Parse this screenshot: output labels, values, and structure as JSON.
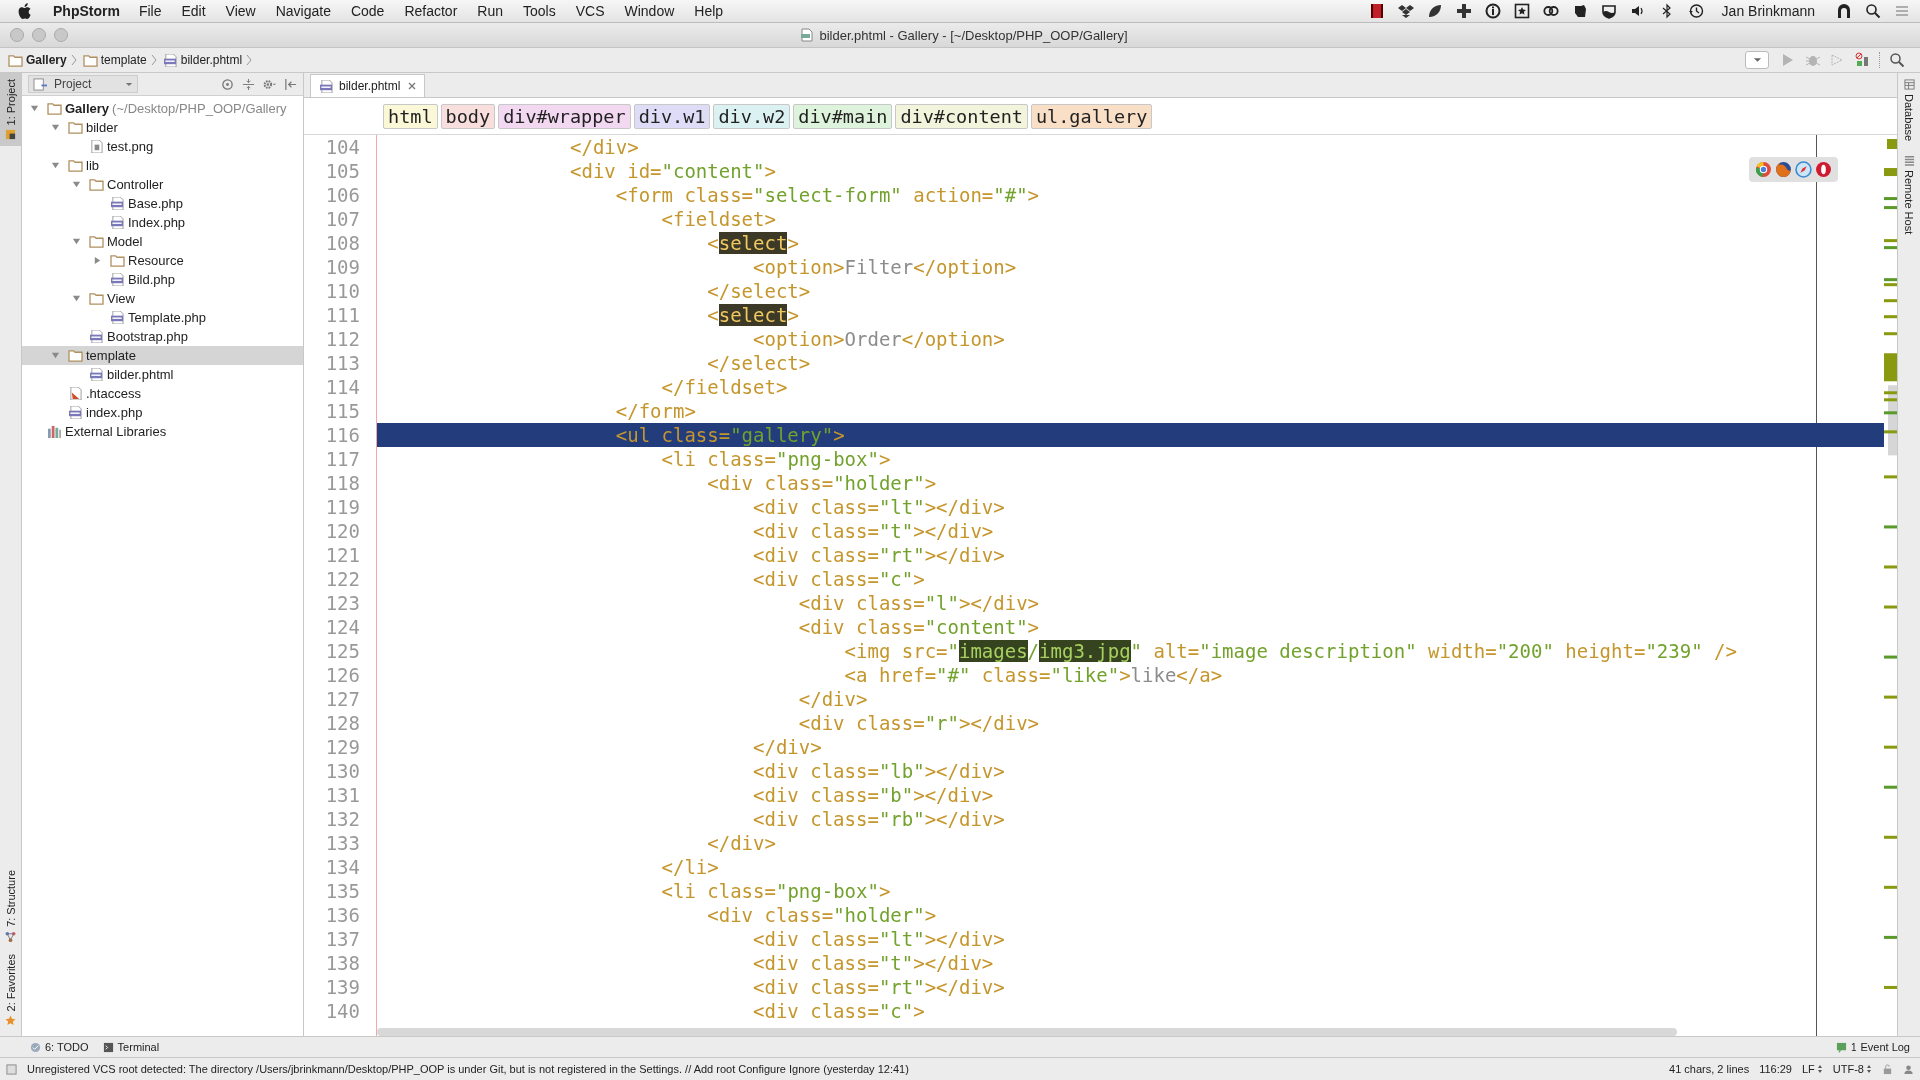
{
  "menu_bar": {
    "app": "PhpStorm",
    "items": [
      "File",
      "Edit",
      "View",
      "Navigate",
      "Code",
      "Refactor",
      "Run",
      "Tools",
      "VCS",
      "Window",
      "Help"
    ],
    "user": "Jan Brinkmann"
  },
  "window": {
    "title": "bilder.phtml - Gallery - [~/Desktop/PHP_OOP/Gallery]"
  },
  "nav_bar": {
    "crumbs": [
      {
        "label": "Gallery",
        "kind": "folder"
      },
      {
        "label": "template",
        "kind": "folder"
      },
      {
        "label": "bilder.phtml",
        "kind": "php"
      }
    ]
  },
  "left_strip": {
    "tabs": [
      {
        "label": "1: Project",
        "kind": "project",
        "selected": true
      },
      {
        "label": "7: Structure",
        "kind": "structure",
        "selected": false
      },
      {
        "label": "2: Favorites",
        "kind": "favorites",
        "selected": false
      }
    ]
  },
  "project_panel": {
    "title": "Project",
    "tree": [
      {
        "label": "Gallery",
        "hint": "(~/Desktop/PHP_OOP/Gallery",
        "kind": "folder",
        "expanded": true,
        "selected": false,
        "children": [
          {
            "label": "bilder",
            "kind": "folder",
            "expanded": true,
            "selected": false,
            "children": [
              {
                "label": "test.png",
                "kind": "image",
                "selected": false
              }
            ]
          },
          {
            "label": "lib",
            "kind": "folder",
            "expanded": true,
            "selected": false,
            "children": [
              {
                "label": "Controller",
                "kind": "folder",
                "expanded": true,
                "selected": false,
                "children": [
                  {
                    "label": "Base.php",
                    "kind": "php",
                    "selected": false
                  },
                  {
                    "label": "Index.php",
                    "kind": "php",
                    "selected": false
                  }
                ]
              },
              {
                "label": "Model",
                "kind": "folder",
                "expanded": true,
                "selected": false,
                "children": [
                  {
                    "label": "Resource",
                    "kind": "folder",
                    "expanded": false,
                    "selected": false
                  },
                  {
                    "label": "Bild.php",
                    "kind": "php",
                    "selected": false
                  }
                ]
              },
              {
                "label": "View",
                "kind": "folder",
                "expanded": true,
                "selected": false,
                "children": [
                  {
                    "label": "Template.php",
                    "kind": "php",
                    "selected": false
                  }
                ]
              },
              {
                "label": "Bootstrap.php",
                "kind": "php",
                "selected": false
              }
            ]
          },
          {
            "label": "template",
            "kind": "folder",
            "expanded": true,
            "selected": true,
            "children": [
              {
                "label": "bilder.phtml",
                "kind": "php",
                "selected": false
              }
            ]
          },
          {
            "label": ".htaccess",
            "kind": "config",
            "selected": false
          },
          {
            "label": "index.php",
            "kind": "php",
            "selected": false
          }
        ]
      },
      {
        "label": "External Libraries",
        "kind": "library",
        "selected": false
      }
    ]
  },
  "editor": {
    "tabs": [
      {
        "label": "bilder.phtml",
        "selected": true
      }
    ],
    "tag_path": [
      {
        "label": "html",
        "color": "#fbf8d8"
      },
      {
        "label": "body",
        "color": "#f9dede"
      },
      {
        "label": "div#wrapper",
        "color": "#f3d8f1"
      },
      {
        "label": "div.w1",
        "color": "#dedcf6"
      },
      {
        "label": "div.w2",
        "color": "#dcf2f2"
      },
      {
        "label": "div#main",
        "color": "#def3dc"
      },
      {
        "label": "div#content",
        "color": "#f2f4dc"
      },
      {
        "label": "ul.gallery",
        "color": "#f9dfc6"
      }
    ],
    "lines": [
      {
        "number": "104",
        "selected": false,
        "tokens": [
          {
            "kind": "tag",
            "text": "                </div>"
          }
        ]
      },
      {
        "number": "105",
        "selected": false,
        "tokens": [
          {
            "kind": "tag",
            "text": "                <div id="
          },
          {
            "kind": "string",
            "text": "\"content\""
          },
          {
            "kind": "tag",
            "text": ">"
          }
        ]
      },
      {
        "number": "106",
        "selected": false,
        "tokens": [
          {
            "kind": "tag",
            "text": "                    <form class="
          },
          {
            "kind": "string",
            "text": "\"select-form\""
          },
          {
            "kind": "tag",
            "text": " action="
          },
          {
            "kind": "string",
            "text": "\"#\""
          },
          {
            "kind": "tag",
            "text": ">"
          }
        ]
      },
      {
        "number": "107",
        "selected": false,
        "tokens": [
          {
            "kind": "tag",
            "text": "                        <fieldset>"
          }
        ]
      },
      {
        "number": "108",
        "selected": false,
        "tokens": [
          {
            "kind": "tag",
            "text": "                            <"
          },
          {
            "kind": "match-tag",
            "text": "select"
          },
          {
            "kind": "tag",
            "text": ">"
          }
        ]
      },
      {
        "number": "109",
        "selected": false,
        "tokens": [
          {
            "kind": "tag",
            "text": "                                <option>"
          },
          {
            "kind": "text",
            "text": "Filter"
          },
          {
            "kind": "tag",
            "text": "</option>"
          }
        ]
      },
      {
        "number": "110",
        "selected": false,
        "tokens": [
          {
            "kind": "tag",
            "text": "                            </select>"
          }
        ]
      },
      {
        "number": "111",
        "selected": false,
        "tokens": [
          {
            "kind": "tag",
            "text": "                            <"
          },
          {
            "kind": "match-tag",
            "text": "select"
          },
          {
            "kind": "tag",
            "text": ">"
          }
        ]
      },
      {
        "number": "112",
        "selected": false,
        "tokens": [
          {
            "kind": "tag",
            "text": "                                <option>"
          },
          {
            "kind": "text",
            "text": "Order"
          },
          {
            "kind": "tag",
            "text": "</option>"
          }
        ]
      },
      {
        "number": "113",
        "selected": false,
        "tokens": [
          {
            "kind": "tag",
            "text": "                            </select>"
          }
        ]
      },
      {
        "number": "114",
        "selected": false,
        "tokens": [
          {
            "kind": "tag",
            "text": "                        </fieldset>"
          }
        ]
      },
      {
        "number": "115",
        "selected": false,
        "tokens": [
          {
            "kind": "tag",
            "text": "                    </form>"
          }
        ]
      },
      {
        "number": "116",
        "selected": true,
        "tokens": [
          {
            "kind": "tag",
            "text": "                    <ul class="
          },
          {
            "kind": "string",
            "text": "\"gallery\""
          },
          {
            "kind": "tag",
            "text": ">"
          }
        ]
      },
      {
        "number": "117",
        "selected": false,
        "tokens": [
          {
            "kind": "tag",
            "text": "                        <li class="
          },
          {
            "kind": "string",
            "text": "\"png-box\""
          },
          {
            "kind": "tag",
            "text": ">"
          }
        ]
      },
      {
        "number": "118",
        "selected": false,
        "tokens": [
          {
            "kind": "tag",
            "text": "                            <div class="
          },
          {
            "kind": "string",
            "text": "\"holder\""
          },
          {
            "kind": "tag",
            "text": ">"
          }
        ]
      },
      {
        "number": "119",
        "selected": false,
        "tokens": [
          {
            "kind": "tag",
            "text": "                                <div class="
          },
          {
            "kind": "string",
            "text": "\"lt\""
          },
          {
            "kind": "tag",
            "text": "></div>"
          }
        ]
      },
      {
        "number": "120",
        "selected": false,
        "tokens": [
          {
            "kind": "tag",
            "text": "                                <div class="
          },
          {
            "kind": "string",
            "text": "\"t\""
          },
          {
            "kind": "tag",
            "text": "></div>"
          }
        ]
      },
      {
        "number": "121",
        "selected": false,
        "tokens": [
          {
            "kind": "tag",
            "text": "                                <div class="
          },
          {
            "kind": "string",
            "text": "\"rt\""
          },
          {
            "kind": "tag",
            "text": "></div>"
          }
        ]
      },
      {
        "number": "122",
        "selected": false,
        "tokens": [
          {
            "kind": "tag",
            "text": "                                <div class="
          },
          {
            "kind": "string",
            "text": "\"c\""
          },
          {
            "kind": "tag",
            "text": ">"
          }
        ]
      },
      {
        "number": "123",
        "selected": false,
        "tokens": [
          {
            "kind": "tag",
            "text": "                                    <div class="
          },
          {
            "kind": "string",
            "text": "\"l\""
          },
          {
            "kind": "tag",
            "text": "></div>"
          }
        ]
      },
      {
        "number": "124",
        "selected": false,
        "tokens": [
          {
            "kind": "tag",
            "text": "                                    <div class="
          },
          {
            "kind": "string",
            "text": "\"content\""
          },
          {
            "kind": "tag",
            "text": ">"
          }
        ]
      },
      {
        "number": "125",
        "selected": false,
        "tokens": [
          {
            "kind": "tag",
            "text": "                                        <img src="
          },
          {
            "kind": "string",
            "text": "\""
          },
          {
            "kind": "match-string",
            "text": "images"
          },
          {
            "kind": "string",
            "text": "/"
          },
          {
            "kind": "match-string",
            "text": "img3.jpg"
          },
          {
            "kind": "string",
            "text": "\""
          },
          {
            "kind": "tag",
            "text": " alt="
          },
          {
            "kind": "string",
            "text": "\"image description\""
          },
          {
            "kind": "tag",
            "text": " width="
          },
          {
            "kind": "string",
            "text": "\"200\""
          },
          {
            "kind": "tag",
            "text": " height="
          },
          {
            "kind": "string",
            "text": "\"239\""
          },
          {
            "kind": "tag",
            "text": " />"
          }
        ]
      },
      {
        "number": "126",
        "selected": false,
        "tokens": [
          {
            "kind": "tag",
            "text": "                                        <a href="
          },
          {
            "kind": "string",
            "text": "\"#\""
          },
          {
            "kind": "tag",
            "text": " class="
          },
          {
            "kind": "string",
            "text": "\"like\""
          },
          {
            "kind": "tag",
            "text": ">"
          },
          {
            "kind": "text",
            "text": "like"
          },
          {
            "kind": "tag",
            "text": "</a>"
          }
        ]
      },
      {
        "number": "127",
        "selected": false,
        "tokens": [
          {
            "kind": "tag",
            "text": "                                    </div>"
          }
        ]
      },
      {
        "number": "128",
        "selected": false,
        "tokens": [
          {
            "kind": "tag",
            "text": "                                    <div class="
          },
          {
            "kind": "string",
            "text": "\"r\""
          },
          {
            "kind": "tag",
            "text": "></div>"
          }
        ]
      },
      {
        "number": "129",
        "selected": false,
        "tokens": [
          {
            "kind": "tag",
            "text": "                                </div>"
          }
        ]
      },
      {
        "number": "130",
        "selected": false,
        "tokens": [
          {
            "kind": "tag",
            "text": "                                <div class="
          },
          {
            "kind": "string",
            "text": "\"lb\""
          },
          {
            "kind": "tag",
            "text": "></div>"
          }
        ]
      },
      {
        "number": "131",
        "selected": false,
        "tokens": [
          {
            "kind": "tag",
            "text": "                                <div class="
          },
          {
            "kind": "string",
            "text": "\"b\""
          },
          {
            "kind": "tag",
            "text": "></div>"
          }
        ]
      },
      {
        "number": "132",
        "selected": false,
        "tokens": [
          {
            "kind": "tag",
            "text": "                                <div class="
          },
          {
            "kind": "string",
            "text": "\"rb\""
          },
          {
            "kind": "tag",
            "text": "></div>"
          }
        ]
      },
      {
        "number": "133",
        "selected": false,
        "tokens": [
          {
            "kind": "tag",
            "text": "                            </div>"
          }
        ]
      },
      {
        "number": "134",
        "selected": false,
        "tokens": [
          {
            "kind": "tag",
            "text": "                        </li>"
          }
        ]
      },
      {
        "number": "135",
        "selected": false,
        "tokens": [
          {
            "kind": "tag",
            "text": "                        <li class="
          },
          {
            "kind": "string",
            "text": "\"png-box\""
          },
          {
            "kind": "tag",
            "text": ">"
          }
        ]
      },
      {
        "number": "136",
        "selected": false,
        "tokens": [
          {
            "kind": "tag",
            "text": "                            <div class="
          },
          {
            "kind": "string",
            "text": "\"holder\""
          },
          {
            "kind": "tag",
            "text": ">"
          }
        ]
      },
      {
        "number": "137",
        "selected": false,
        "tokens": [
          {
            "kind": "tag",
            "text": "                                <div class="
          },
          {
            "kind": "string",
            "text": "\"lt\""
          },
          {
            "kind": "tag",
            "text": "></div>"
          }
        ]
      },
      {
        "number": "138",
        "selected": false,
        "tokens": [
          {
            "kind": "tag",
            "text": "                                <div class="
          },
          {
            "kind": "string",
            "text": "\"t\""
          },
          {
            "kind": "tag",
            "text": "></div>"
          }
        ]
      },
      {
        "number": "139",
        "selected": false,
        "tokens": [
          {
            "kind": "tag",
            "text": "                                <div class="
          },
          {
            "kind": "string",
            "text": "\"rt\""
          },
          {
            "kind": "tag",
            "text": "></div>"
          }
        ]
      },
      {
        "number": "140",
        "selected": false,
        "tokens": [
          {
            "kind": "tag",
            "text": "                                <div class="
          },
          {
            "kind": "string",
            "text": "\"c\""
          },
          {
            "kind": "tag",
            "text": ">"
          }
        ]
      }
    ]
  },
  "right_strip": {
    "tabs": [
      {
        "label": "Database",
        "kind": "database"
      },
      {
        "label": "Remote Host",
        "kind": "remote"
      }
    ]
  },
  "tool_strip": {
    "tabs": [
      {
        "label": "6: TODO",
        "kind": "todo"
      },
      {
        "label": "Terminal",
        "kind": "terminal"
      }
    ],
    "event_count": "1",
    "event_log": "Event Log"
  },
  "status_bar": {
    "message": "Unregistered VCS root detected: The directory /Users/jbrinkmann/Desktop/PHP_OOP is under Git, but is not registered in the Settings. // Add root  Configure  Ignore (yesterday 12:41)",
    "selection": "41 chars, 2 lines",
    "position": "116:29",
    "line_separator": "LF",
    "encoding": "UTF-8"
  }
}
